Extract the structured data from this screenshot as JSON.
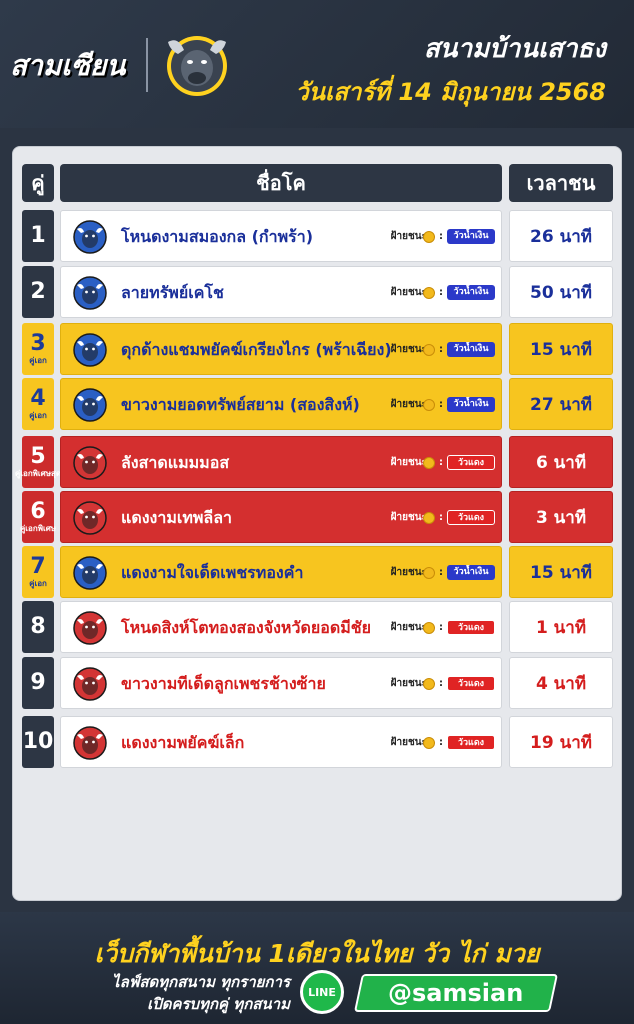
{
  "header": {
    "logo": "สามเซียน",
    "title": "สนามบ้านเสาธง",
    "date": "วันเสาร์ที่ 14 มิถุนายน 2568"
  },
  "table": {
    "col_num": "คู่",
    "col_name": "ชื่อโค",
    "col_time": "เวลาชน",
    "side_label": "ฝ้ายชนะ",
    "colon": ":",
    "rows": [
      {
        "num": "1",
        "sub": "",
        "style": "white",
        "name": "โหนดงามสมองกล (กำพร้า)",
        "bull": "blue",
        "tag": "วัวน้ำเงิน",
        "tagcolor": "blue",
        "time": "26 นาที",
        "namecolor": "blue"
      },
      {
        "num": "2",
        "sub": "",
        "style": "white",
        "name": "ลายทรัพย์เคโช",
        "bull": "blue",
        "tag": "วัวน้ำเงิน",
        "tagcolor": "blue",
        "time": "50 นาที",
        "namecolor": "blue"
      },
      {
        "num": "3",
        "sub": "คู่เอก",
        "style": "yellow",
        "name": "ดุกด้างแชมพยัคฆ์เกรียงไกร (พร้าเฉียง)",
        "bull": "blue",
        "tag": "วัวน้ำเงิน",
        "tagcolor": "blue",
        "time": "15 นาที",
        "namecolor": "blue"
      },
      {
        "num": "4",
        "sub": "คู่เอก",
        "style": "yellow",
        "name": "ขาวงามยอดทรัพย์สยาม (สองสิงห์)",
        "bull": "blue",
        "tag": "วัวน้ำเงิน",
        "tagcolor": "blue",
        "time": "27 นาที",
        "namecolor": "blue"
      },
      {
        "num": "5",
        "sub": "คู่เอกพิเศษสุด",
        "style": "red",
        "name": "ลังสาดแมมมอส",
        "bull": "red",
        "tag": "วัวแดง",
        "tagcolor": "red",
        "time": "6 นาที",
        "namecolor": "white"
      },
      {
        "num": "6",
        "sub": "คู่เอกพิเศษ",
        "style": "red",
        "name": "แดงงามเทพลีลา",
        "bull": "red",
        "tag": "วัวแดง",
        "tagcolor": "red",
        "time": "3 นาที",
        "namecolor": "white"
      },
      {
        "num": "7",
        "sub": "คู่เอก",
        "style": "yellow",
        "name": "แดงงามใจเด็ดเพชรทองคำ",
        "bull": "blue",
        "tag": "วัวน้ำเงิน",
        "tagcolor": "blue",
        "time": "15 นาที",
        "namecolor": "blue"
      },
      {
        "num": "8",
        "sub": "",
        "style": "white",
        "name": "โหนดสิงห์โตทองสองจังหวัดยอดมีชัย",
        "bull": "red",
        "tag": "วัวแดง",
        "tagcolor": "red",
        "time": "1 นาที",
        "namecolor": "red"
      },
      {
        "num": "9",
        "sub": "",
        "style": "white",
        "name": "ขาวงามทีเด็ดลูกเพชรช้างซ้าย",
        "bull": "red",
        "tag": "วัวแดง",
        "tagcolor": "red",
        "time": "4 นาที",
        "namecolor": "red"
      },
      {
        "num": "10",
        "sub": "",
        "style": "white",
        "name": "แดงงามพยัคฆ์เล็ก",
        "bull": "red",
        "tag": "วัวแดง",
        "tagcolor": "red",
        "time": "19 นาที",
        "namecolor": "red"
      }
    ]
  },
  "footer": {
    "slogan": "เว็บกีฬาพื้นบ้าน 1เดียวในไทย  วัว  ไก่  มวย",
    "line1": "ไลฟ์สดทุกสนาม ทุกรายการ",
    "line2": "เปิดครบทุกคู่ ทุกสนาม",
    "line_label": "LINE",
    "line_id": "@samsian"
  },
  "colors": {
    "yellow": "#f7c51f",
    "red": "#d42f2f",
    "navy": "#2d3644",
    "blue_text": "#1a2f9a"
  }
}
